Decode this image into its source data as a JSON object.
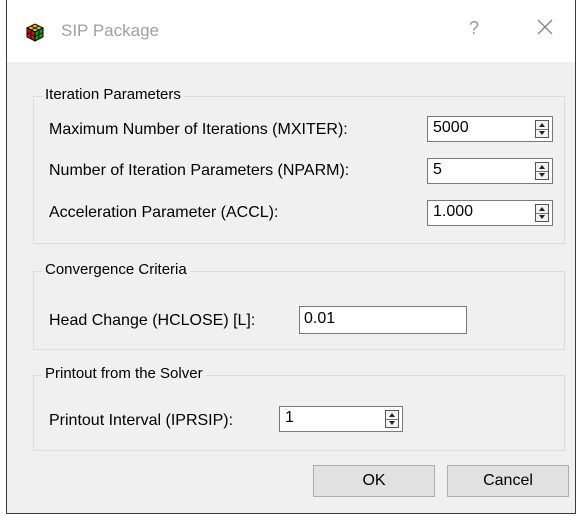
{
  "window": {
    "title": "SIP Package",
    "help_label": "?"
  },
  "iteration": {
    "title": "Iteration Parameters",
    "rows": [
      {
        "label": "Maximum Number of Iterations (MXITER):",
        "value": "5000"
      },
      {
        "label": "Number of Iteration Parameters (NPARM):",
        "value": "5"
      },
      {
        "label": "Acceleration Parameter (ACCL):",
        "value": "1.000"
      }
    ]
  },
  "convergence": {
    "title": "Convergence Criteria",
    "label": "Head Change (HCLOSE) [L]:",
    "value": "0.01"
  },
  "printout": {
    "title": "Printout from the Solver",
    "label": "Printout Interval (IPRSIP):",
    "value": "1"
  },
  "buttons": {
    "ok": "OK",
    "cancel": "Cancel"
  }
}
